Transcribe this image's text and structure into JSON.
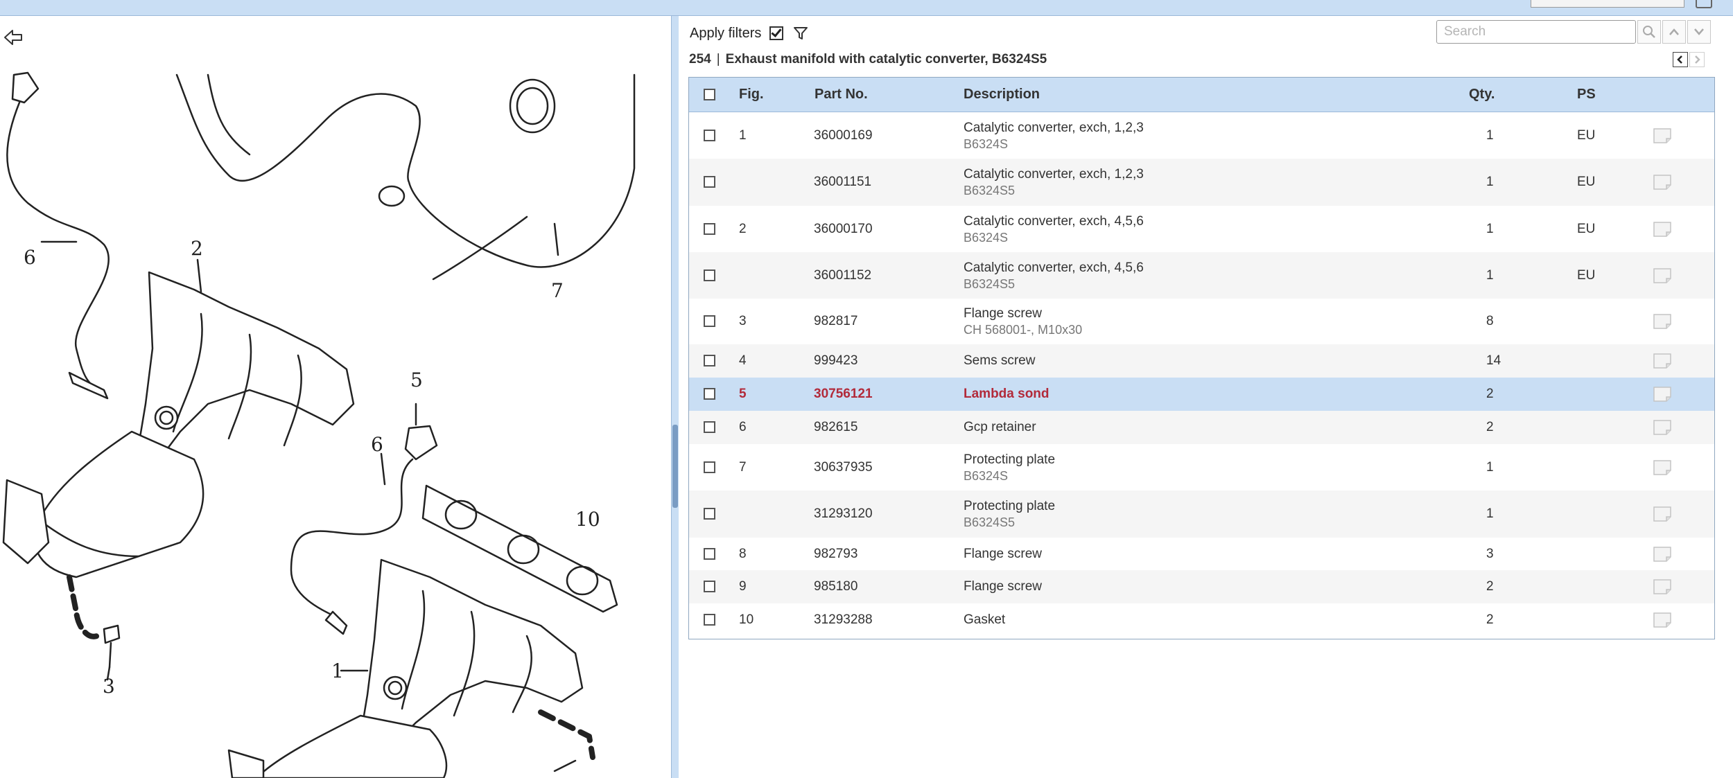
{
  "toolbar": {
    "apply_filters_label": "Apply filters",
    "apply_filters_checked": true,
    "search_placeholder": "Search"
  },
  "group": {
    "number": "254",
    "separator": "|",
    "title": "Exhaust manifold with catalytic converter, B6324S5"
  },
  "diagram": {
    "callouts": [
      "6",
      "2",
      "7",
      "5",
      "6",
      "10",
      "1",
      "3"
    ]
  },
  "table": {
    "columns": {
      "fig": "Fig.",
      "part_no": "Part No.",
      "description": "Description",
      "qty": "Qty.",
      "ps": "PS"
    },
    "rows": [
      {
        "fig": "1",
        "part_no": "36000169",
        "description": "Catalytic converter, exch, 1,2,3",
        "sub": "B6324S",
        "qty": "1",
        "ps": "EU"
      },
      {
        "fig": "",
        "part_no": "36001151",
        "description": "Catalytic converter, exch, 1,2,3",
        "sub": "B6324S5",
        "qty": "1",
        "ps": "EU"
      },
      {
        "fig": "2",
        "part_no": "36000170",
        "description": "Catalytic converter, exch, 4,5,6",
        "sub": "B6324S",
        "qty": "1",
        "ps": "EU"
      },
      {
        "fig": "",
        "part_no": "36001152",
        "description": "Catalytic converter, exch, 4,5,6",
        "sub": "B6324S5",
        "qty": "1",
        "ps": "EU"
      },
      {
        "fig": "3",
        "part_no": "982817",
        "description": "Flange screw",
        "sub": "CH 568001-, M10x30",
        "qty": "8",
        "ps": ""
      },
      {
        "fig": "4",
        "part_no": "999423",
        "description": "Sems screw",
        "sub": "",
        "qty": "14",
        "ps": ""
      },
      {
        "fig": "5",
        "part_no": "30756121",
        "description": "Lambda sond",
        "sub": "",
        "qty": "2",
        "ps": "",
        "selected": true
      },
      {
        "fig": "6",
        "part_no": "982615",
        "description": "Gcp retainer",
        "sub": "",
        "qty": "2",
        "ps": ""
      },
      {
        "fig": "7",
        "part_no": "30637935",
        "description": "Protecting plate",
        "sub": "B6324S",
        "qty": "1",
        "ps": ""
      },
      {
        "fig": "",
        "part_no": "31293120",
        "description": "Protecting plate",
        "sub": "B6324S5",
        "qty": "1",
        "ps": ""
      },
      {
        "fig": "8",
        "part_no": "982793",
        "description": "Flange screw",
        "sub": "",
        "qty": "3",
        "ps": ""
      },
      {
        "fig": "9",
        "part_no": "985180",
        "description": "Flange screw",
        "sub": "",
        "qty": "2",
        "ps": ""
      },
      {
        "fig": "10",
        "part_no": "31293288",
        "description": "Gasket",
        "sub": "",
        "qty": "2",
        "ps": ""
      }
    ]
  },
  "colors": {
    "header_bg": "#c9def4",
    "selected_row_bg": "#c9def4",
    "selected_text": "#b22a3a",
    "alt_row_bg": "#f5f5f5"
  }
}
